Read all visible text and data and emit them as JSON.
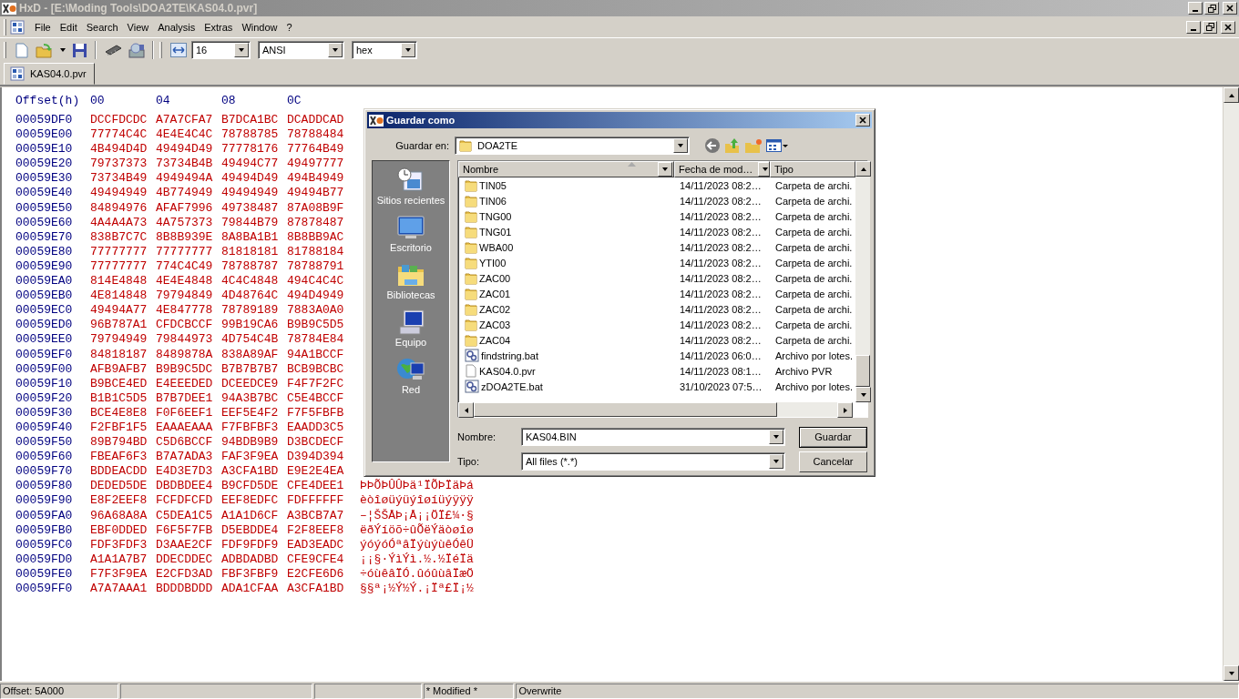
{
  "window": {
    "title": "HxD - [E:\\Moding Tools\\DOA2TE\\KAS04.0.pvr]"
  },
  "menu": [
    "File",
    "Edit",
    "Search",
    "View",
    "Analysis",
    "Extras",
    "Window",
    "?"
  ],
  "toolbar": {
    "bytes_per_row": "16",
    "charset": "ANSI",
    "offset_base": "hex"
  },
  "tabs": [
    {
      "label": "KAS04.0.pvr",
      "selected": true
    }
  ],
  "hex_view": {
    "header": [
      "Offset(h)",
      "00",
      "04",
      "08",
      "0C"
    ],
    "rows": [
      {
        "offset": "00059DF0",
        "groups": [
          "DCCFDCDC",
          "A7A7CFA7",
          "B7DCA1BC",
          "DCADDCAD"
        ]
      },
      {
        "offset": "00059E00",
        "groups": [
          "77774C4C",
          "4E4E4C4C",
          "78788785",
          "78788484"
        ]
      },
      {
        "offset": "00059E10",
        "groups": [
          "4B494D4D",
          "49494D49",
          "77778176",
          "77764B49"
        ]
      },
      {
        "offset": "00059E20",
        "groups": [
          "79737373",
          "73734B4B",
          "49494C77",
          "49497777"
        ]
      },
      {
        "offset": "00059E30",
        "groups": [
          "73734B49",
          "4949494A",
          "49494D49",
          "494B4949"
        ]
      },
      {
        "offset": "00059E40",
        "groups": [
          "49494949",
          "4B774949",
          "49494949",
          "49494B77"
        ]
      },
      {
        "offset": "00059E50",
        "groups": [
          "84894976",
          "AFAF7996",
          "49738487",
          "87A08B9F"
        ]
      },
      {
        "offset": "00059E60",
        "groups": [
          "4A4A4A73",
          "4A757373",
          "79844B79",
          "87878487"
        ]
      },
      {
        "offset": "00059E70",
        "groups": [
          "838B7C7C",
          "8B8B939E",
          "8A8BA1B1",
          "8B8BB9AC"
        ]
      },
      {
        "offset": "00059E80",
        "groups": [
          "77777777",
          "77777777",
          "81818181",
          "81788184"
        ]
      },
      {
        "offset": "00059E90",
        "groups": [
          "77777777",
          "774C4C49",
          "78788787",
          "78788791"
        ]
      },
      {
        "offset": "00059EA0",
        "groups": [
          "814E4848",
          "4E4E4848",
          "4C4C4848",
          "494C4C4C"
        ]
      },
      {
        "offset": "00059EB0",
        "groups": [
          "4E814848",
          "79794849",
          "4D48764C",
          "494D4949"
        ]
      },
      {
        "offset": "00059EC0",
        "groups": [
          "49494A77",
          "4E847778",
          "78789189",
          "7883A0A0"
        ]
      },
      {
        "offset": "00059ED0",
        "groups": [
          "96B787A1",
          "CFDCBCCF",
          "99B19CA6",
          "B9B9C5D5"
        ]
      },
      {
        "offset": "00059EE0",
        "groups": [
          "79794949",
          "79844973",
          "4D754C4B",
          "78784E84"
        ]
      },
      {
        "offset": "00059EF0",
        "groups": [
          "84818187",
          "8489878A",
          "838A89AF",
          "94A1BCCF"
        ]
      },
      {
        "offset": "00059F00",
        "groups": [
          "AFB9AFB7",
          "B9B9C5DC",
          "B7B7B7B7",
          "BCB9BCBC"
        ]
      },
      {
        "offset": "00059F10",
        "groups": [
          "B9BCE4ED",
          "E4EEEDED",
          "DCEEDCE9",
          "F4F7F2FC"
        ]
      },
      {
        "offset": "00059F20",
        "groups": [
          "B1B1C5D5",
          "B7B7DEE1",
          "94A3B7BC",
          "C5E4BCCF"
        ]
      },
      {
        "offset": "00059F30",
        "groups": [
          "BCE4E8E8",
          "F0F6EEF1",
          "EEF5E4F2",
          "F7F5FBFB"
        ]
      },
      {
        "offset": "00059F40",
        "groups": [
          "F2FBF1F5",
          "EAAAEAAA",
          "F7FBFBF3",
          "EAADD3C5"
        ]
      },
      {
        "offset": "00059F50",
        "groups": [
          "89B794BD",
          "C5D6BCCF",
          "94BDB9B9",
          "D3BCDECF"
        ]
      },
      {
        "offset": "00059F60",
        "groups": [
          "FBEAF6F3",
          "B7A7ADA3",
          "FAF3F9EA",
          "D394D394"
        ]
      },
      {
        "offset": "00059F70",
        "groups": [
          "BDDEACDD",
          "E4D3E7D3",
          "A3CFA1BD",
          "E9E2E4EA"
        ]
      },
      {
        "offset": "00059F80",
        "groups": [
          "DEDED5DE",
          "DBDBDEE4",
          "B9CFD5DE",
          "CFE4DEE1"
        ],
        "ascii": "ÞÞÕÞÛÛÞä¹ÏÕÞÏäÞá"
      },
      {
        "offset": "00059F90",
        "groups": [
          "E8F2EEF8",
          "FCFDFCFD",
          "EEF8EDFC",
          "FDFFFFFF"
        ],
        "ascii": "èòîøüýüýîøíüýÿÿÿ"
      },
      {
        "offset": "00059FA0",
        "groups": [
          "96A68A8A",
          "C5DEA1C5",
          "A1A1D6CF",
          "A3BCB7A7"
        ],
        "ascii": "–¦ŠŠÅÞ¡Å¡¡ÖÏ£¼·§"
      },
      {
        "offset": "00059FB0",
        "groups": [
          "EBF0DDED",
          "F6F5F7FB",
          "D5EBDDE4",
          "F2F8EEF8"
        ],
        "ascii": "ëðÝíöõ÷ûÕëÝäòøîø"
      },
      {
        "offset": "00059FC0",
        "groups": [
          "FDF3FDF3",
          "D3AAE2CF",
          "FDF9FDF9",
          "EAD3EADC"
        ],
        "ascii": "ýóýóÓªâÏýùýùêÓêÜ"
      },
      {
        "offset": "00059FD0",
        "groups": [
          "A1A1A7B7",
          "DDECDDEC",
          "ADBDADBD",
          "CFE9CFE4"
        ],
        "ascii": "¡¡§·ÝìÝì.½.½ÏéÏä"
      },
      {
        "offset": "00059FE0",
        "groups": [
          "F7F3F9EA",
          "E2CFD3AD",
          "FBF3FBF9",
          "E2CFE6D6"
        ],
        "ascii": "÷óùêâÏÓ.ûóûùâÏæÖ"
      },
      {
        "offset": "00059FF0",
        "groups": [
          "A7A7AAA1",
          "BDDDBDDD",
          "ADA1CFAA",
          "A3CFA1BD"
        ],
        "ascii": "§§ª¡½Ý½Ý.¡Ïª£Ï¡½"
      }
    ]
  },
  "dialog": {
    "title": "Guardar como",
    "save_in_label": "Guardar en:",
    "folder": "DOA2TE",
    "places": [
      {
        "label": "Sitios recientes",
        "kind": "recent"
      },
      {
        "label": "Escritorio",
        "kind": "desktop"
      },
      {
        "label": "Bibliotecas",
        "kind": "libraries"
      },
      {
        "label": "Equipo",
        "kind": "computer"
      },
      {
        "label": "Red",
        "kind": "network"
      }
    ],
    "columns": [
      "Nombre",
      "Fecha de mod…",
      "Tipo"
    ],
    "files": [
      {
        "name": "TIN05",
        "date": "14/11/2023 08:2…",
        "type": "Carpeta de archi.",
        "kind": "folder"
      },
      {
        "name": "TIN06",
        "date": "14/11/2023 08:2…",
        "type": "Carpeta de archi.",
        "kind": "folder"
      },
      {
        "name": "TNG00",
        "date": "14/11/2023 08:2…",
        "type": "Carpeta de archi.",
        "kind": "folder"
      },
      {
        "name": "TNG01",
        "date": "14/11/2023 08:2…",
        "type": "Carpeta de archi.",
        "kind": "folder"
      },
      {
        "name": "WBA00",
        "date": "14/11/2023 08:2…",
        "type": "Carpeta de archi.",
        "kind": "folder"
      },
      {
        "name": "YTI00",
        "date": "14/11/2023 08:2…",
        "type": "Carpeta de archi.",
        "kind": "folder"
      },
      {
        "name": "ZAC00",
        "date": "14/11/2023 08:2…",
        "type": "Carpeta de archi.",
        "kind": "folder"
      },
      {
        "name": "ZAC01",
        "date": "14/11/2023 08:2…",
        "type": "Carpeta de archi.",
        "kind": "folder"
      },
      {
        "name": "ZAC02",
        "date": "14/11/2023 08:2…",
        "type": "Carpeta de archi.",
        "kind": "folder"
      },
      {
        "name": "ZAC03",
        "date": "14/11/2023 08:2…",
        "type": "Carpeta de archi.",
        "kind": "folder"
      },
      {
        "name": "ZAC04",
        "date": "14/11/2023 08:2…",
        "type": "Carpeta de archi.",
        "kind": "folder"
      },
      {
        "name": "findstring.bat",
        "date": "14/11/2023 06:0…",
        "type": "Archivo por lotes.",
        "kind": "batch"
      },
      {
        "name": "KAS04.0.pvr",
        "date": "14/11/2023 08:1…",
        "type": "Archivo PVR",
        "kind": "file"
      },
      {
        "name": "zDOA2TE.bat",
        "date": "31/10/2023 07:5…",
        "type": "Archivo por lotes.",
        "kind": "batch"
      }
    ],
    "name_label": "Nombre:",
    "name_value": "KAS04.BIN",
    "type_label": "Tipo:",
    "type_value": "All files (*.*)",
    "buttons": [
      "Guardar",
      "Cancelar"
    ]
  },
  "status_bar": {
    "offset": "Offset: 5A000",
    "modified": "* Modified *",
    "mode": "Overwrite"
  }
}
